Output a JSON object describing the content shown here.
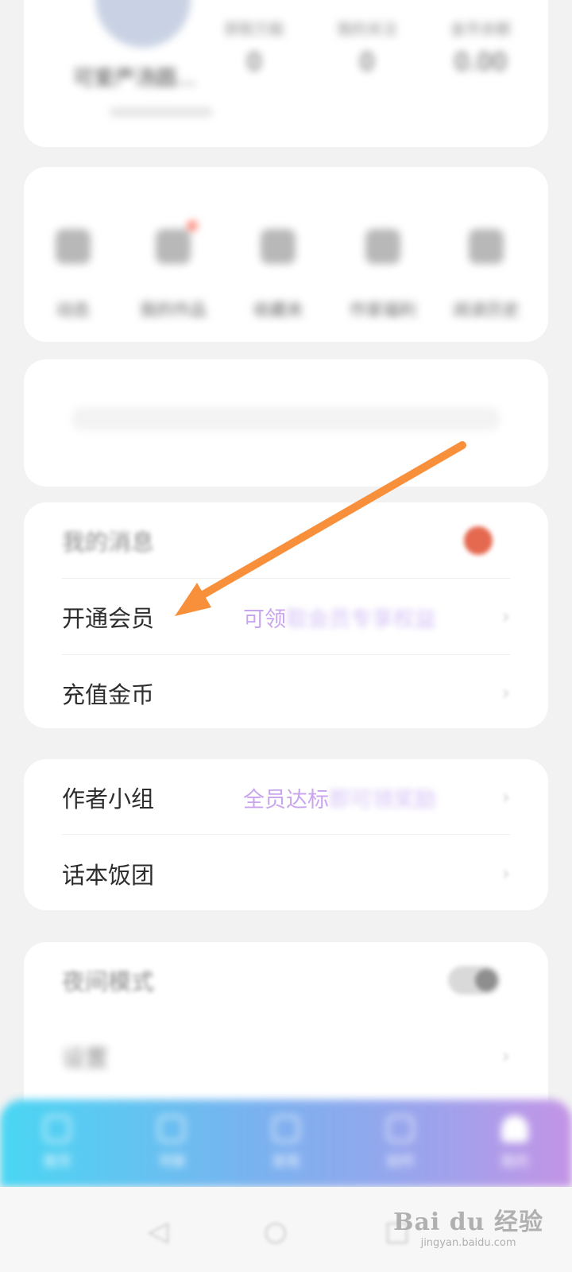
{
  "profile": {
    "username": "可爱严汤圆...",
    "stats": [
      {
        "label": "获取万能",
        "value": "0"
      },
      {
        "label": "我的关注",
        "value": "0"
      },
      {
        "label": "金币余额",
        "value": "0.00"
      }
    ]
  },
  "functions": [
    {
      "label": "动态",
      "icon": "pen-icon"
    },
    {
      "label": "我的作品",
      "icon": "book-icon"
    },
    {
      "label": "收藏夹",
      "icon": "collection-icon"
    },
    {
      "label": "作家福利",
      "icon": "gift-icon"
    },
    {
      "label": "阅读历史",
      "icon": "history-icon"
    }
  ],
  "menu": {
    "messages": {
      "label": "我的消息"
    },
    "vip": {
      "label": "开通会员",
      "hint_clear": "可领",
      "hint_blurred": "取会员专享权益"
    },
    "coins": {
      "label": "充值金币"
    },
    "author_group": {
      "label": "作者小组",
      "hint_clear": "全员达标",
      "hint_blurred": "即可领奖励"
    },
    "huaben_group": {
      "label": "话本饭团"
    },
    "night_mode": {
      "label": "夜间模式"
    },
    "settings": {
      "label": "设置"
    }
  },
  "tabbar": [
    {
      "label": "首页"
    },
    {
      "label": "书架"
    },
    {
      "label": "发现"
    },
    {
      "label": "创作"
    },
    {
      "label": "我的"
    }
  ],
  "watermark": {
    "brand": "Bai du 经验",
    "url": "jingyan.baidu.com"
  },
  "colors": {
    "accent_orange": "#F8903B",
    "tab_gradient_start": "#4AD6F3",
    "tab_gradient_end": "#C494E6",
    "hint_purple": "#C9A5EF"
  }
}
